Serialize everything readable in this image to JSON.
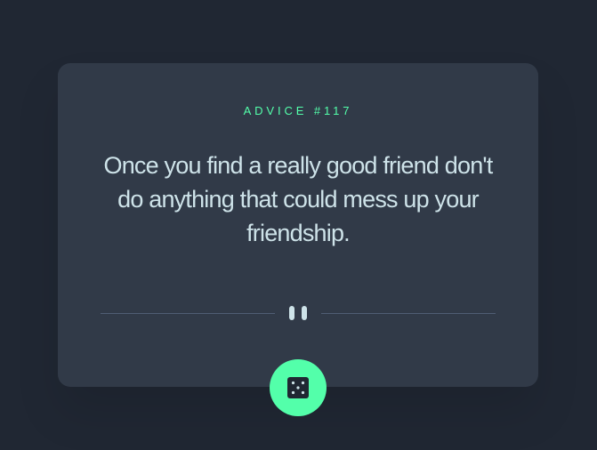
{
  "card": {
    "advice_label": "ADVICE #117",
    "quote": "Once you find a really good friend don't do anything that could mess up your friendship."
  },
  "icons": {
    "divider": "pause-divider-icon",
    "button": "dice-icon"
  },
  "colors": {
    "background": "#202733",
    "card": "#313a48",
    "accent": "#53ffaa",
    "text": "#cee3e9",
    "divider": "#4f5d74"
  }
}
